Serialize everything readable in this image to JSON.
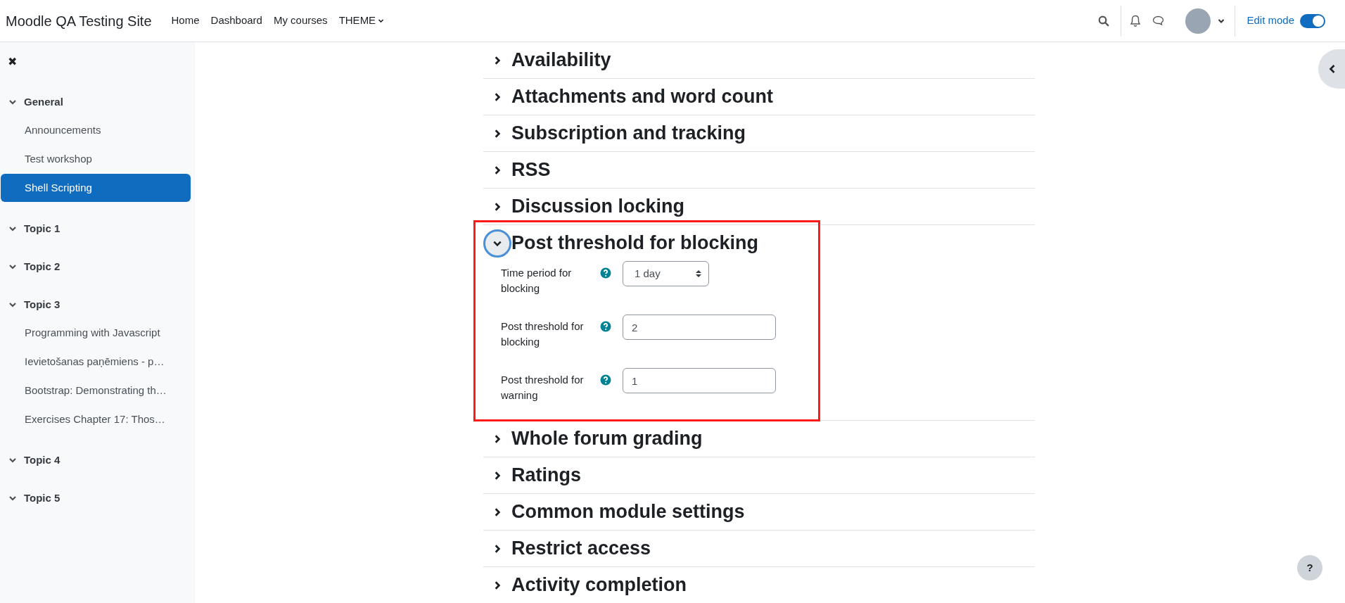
{
  "navbar": {
    "site_name": "Moodle QA Testing Site",
    "links": [
      {
        "label": "Home",
        "kind": "link"
      },
      {
        "label": "Dashboard",
        "kind": "link"
      },
      {
        "label": "My courses",
        "kind": "link"
      },
      {
        "label": "THEME",
        "kind": "dropdown"
      }
    ],
    "edit_mode": {
      "label": "Edit mode",
      "on": true
    }
  },
  "course_index": {
    "close": "✖",
    "sections": [
      {
        "title": "General",
        "expanded": true,
        "items": [
          {
            "label": "Announcements",
            "selected": false
          },
          {
            "label": "Test workshop",
            "selected": false
          },
          {
            "label": "Shell Scripting",
            "selected": true
          }
        ]
      },
      {
        "title": "Topic 1",
        "expanded": true
      },
      {
        "title": "Topic 2",
        "expanded": true
      },
      {
        "title": "Topic 3",
        "expanded": true,
        "items": [
          {
            "label": "Programming with Javascript",
            "selected": false
          },
          {
            "label": "Ievietošanas paņēmiens - p…",
            "selected": false
          },
          {
            "label": "Bootstrap: Demonstrating th…",
            "selected": false
          },
          {
            "label": "Exercises Chapter 17: Thos…",
            "selected": false
          }
        ]
      },
      {
        "title": "Topic 4",
        "expanded": true
      },
      {
        "title": "Topic 5",
        "expanded": true
      }
    ]
  },
  "settings_sections": [
    {
      "title": "Availability",
      "expanded": false,
      "highlighted": false
    },
    {
      "title": "Attachments and word count",
      "expanded": false,
      "highlighted": false
    },
    {
      "title": "Subscription and tracking",
      "expanded": false,
      "highlighted": false
    },
    {
      "title": "RSS",
      "expanded": false,
      "highlighted": false
    },
    {
      "title": "Discussion locking",
      "expanded": false,
      "highlighted": false
    },
    {
      "title": "Post threshold for blocking",
      "expanded": true,
      "highlighted": true,
      "fields": [
        {
          "label": "Time period for blocking",
          "kind": "select",
          "value": "1 day"
        },
        {
          "label": "Post threshold for blocking",
          "kind": "text",
          "value": "2"
        },
        {
          "label": "Post threshold for warning",
          "kind": "text",
          "value": "1"
        }
      ]
    },
    {
      "title": "Whole forum grading",
      "expanded": false,
      "highlighted": false
    },
    {
      "title": "Ratings",
      "expanded": false,
      "highlighted": false
    },
    {
      "title": "Common module settings",
      "expanded": false,
      "highlighted": false
    },
    {
      "title": "Restrict access",
      "expanded": false,
      "highlighted": false
    },
    {
      "title": "Activity completion",
      "expanded": false,
      "highlighted": false
    }
  ],
  "help_button": "?"
}
